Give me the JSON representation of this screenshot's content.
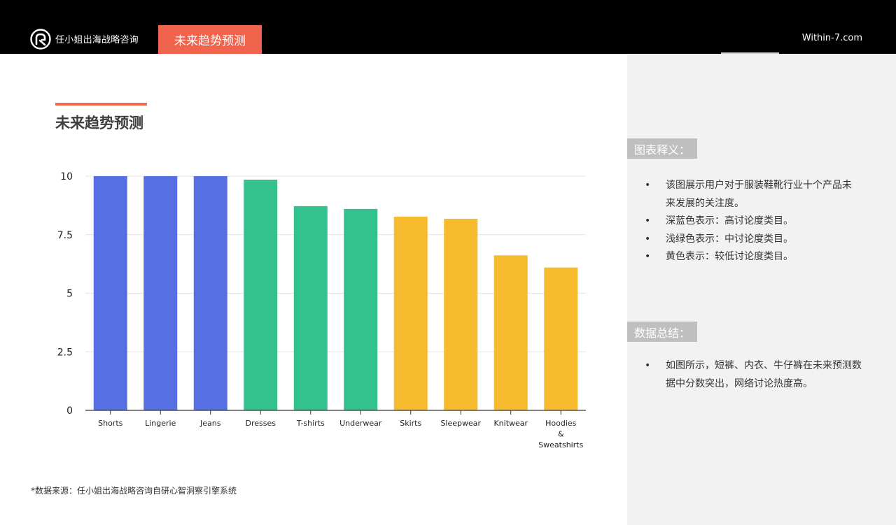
{
  "header": {
    "brand_name": "任小姐出海战略咨询",
    "active_tab": "未来趋势预测",
    "site_url": "Within-7.com"
  },
  "main": {
    "title": "未来趋势预测",
    "source_note": "*数据来源：任小姐出海战略咨询自研心智洞察引擎系统"
  },
  "side": {
    "legend_title": "图表释义：",
    "legend_items": [
      "该图展示用户对于服装鞋靴行业十个产品未来发展的关注度。",
      "深蓝色表示：高讨论度类目。",
      "浅绿色表示：中讨论度类目。",
      "黄色表示：较低讨论度类目。"
    ],
    "summary_title": "数据总结：",
    "summary_items": [
      "如图所示，短裤、内衣、牛仔裤在未来预测数据中分数突出，网络讨论热度高。"
    ]
  },
  "chart_data": {
    "type": "bar",
    "categories": [
      "Shorts",
      "Lingerie",
      "Jeans",
      "Dresses",
      "T-shirts",
      "Underwear",
      "Skirts",
      "Sleepwear",
      "Knitwear",
      "Hoodies & Sweatshirts"
    ],
    "category_lines": [
      [
        "Shorts"
      ],
      [
        "Lingerie"
      ],
      [
        "Jeans"
      ],
      [
        "Dresses"
      ],
      [
        "T-shirts"
      ],
      [
        "Underwear"
      ],
      [
        "Skirts"
      ],
      [
        "Sleepwear"
      ],
      [
        "Knitwear"
      ],
      [
        "Hoodies",
        "&",
        "Sweatshirts"
      ]
    ],
    "values": [
      10,
      10,
      10,
      9.85,
      8.72,
      8.6,
      8.27,
      8.18,
      6.62,
      6.1
    ],
    "bar_colors": [
      "#5670e4",
      "#5670e4",
      "#5670e4",
      "#33c18e",
      "#33c18e",
      "#33c18e",
      "#f6bb2f",
      "#f6bb2f",
      "#f6bb2f",
      "#f6bb2f"
    ],
    "ylim": [
      0,
      10
    ],
    "yticks": [
      0,
      2.5,
      5,
      7.5,
      10
    ],
    "ytick_labels": [
      "0",
      "2.5",
      "5",
      "7.5",
      "10"
    ],
    "title": "",
    "xlabel": "",
    "ylabel": "",
    "grid": true
  },
  "colors": {
    "accent": "#f0634d",
    "high": "#5670e4",
    "medium": "#33c18e",
    "low": "#f6bb2f"
  }
}
